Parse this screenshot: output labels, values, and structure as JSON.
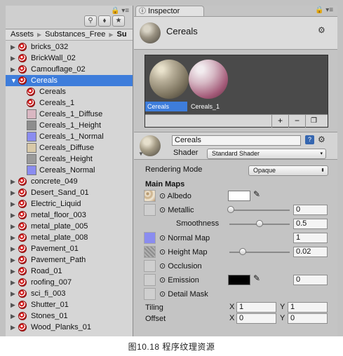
{
  "caption": "图10.18    程序纹理资源",
  "project": {
    "breadcrumb": [
      "Assets",
      "Substances_Free",
      "Su"
    ],
    "tree": [
      {
        "label": "bricks_032",
        "kind": "substance",
        "level": 0,
        "toggle": "collapsed"
      },
      {
        "label": "BrickWall_02",
        "kind": "substance",
        "level": 0,
        "toggle": "collapsed"
      },
      {
        "label": "Camouflage_02",
        "kind": "substance",
        "level": 0,
        "toggle": "collapsed"
      },
      {
        "label": "Cereals",
        "kind": "substance",
        "level": 0,
        "toggle": "expanded",
        "selected": true
      },
      {
        "label": "Cereals",
        "kind": "material",
        "level": 1
      },
      {
        "label": "Cereals_1",
        "kind": "material",
        "level": 1
      },
      {
        "label": "Cereals_1_Diffuse",
        "kind": "texture",
        "level": 1,
        "color": "#d9b7c2"
      },
      {
        "label": "Cereals_1_Height",
        "kind": "texture",
        "level": 1,
        "color": "#8d8d8d"
      },
      {
        "label": "Cereals_1_Normal",
        "kind": "texture",
        "level": 1,
        "color": "#8a8cf0"
      },
      {
        "label": "Cereals_Diffuse",
        "kind": "texture",
        "level": 1,
        "color": "#d8c9a8"
      },
      {
        "label": "Cereals_Height",
        "kind": "texture",
        "level": 1,
        "color": "#9a9a9a"
      },
      {
        "label": "Cereals_Normal",
        "kind": "texture",
        "level": 1,
        "color": "#8a8cf0"
      },
      {
        "label": "concrete_049",
        "kind": "substance",
        "level": 0,
        "toggle": "collapsed"
      },
      {
        "label": "Desert_Sand_01",
        "kind": "substance",
        "level": 0,
        "toggle": "collapsed"
      },
      {
        "label": "Electric_Liquid",
        "kind": "substance",
        "level": 0,
        "toggle": "collapsed"
      },
      {
        "label": "metal_floor_003",
        "kind": "substance",
        "level": 0,
        "toggle": "collapsed"
      },
      {
        "label": "metal_plate_005",
        "kind": "substance",
        "level": 0,
        "toggle": "collapsed"
      },
      {
        "label": "metal_plate_008",
        "kind": "substance",
        "level": 0,
        "toggle": "collapsed"
      },
      {
        "label": "Pavement_01",
        "kind": "substance",
        "level": 0,
        "toggle": "collapsed"
      },
      {
        "label": "Pavement_Path",
        "kind": "substance",
        "level": 0,
        "toggle": "collapsed"
      },
      {
        "label": "Road_01",
        "kind": "substance",
        "level": 0,
        "toggle": "collapsed"
      },
      {
        "label": "roofing_007",
        "kind": "substance",
        "level": 0,
        "toggle": "collapsed"
      },
      {
        "label": "sci_fi_003",
        "kind": "substance",
        "level": 0,
        "toggle": "collapsed"
      },
      {
        "label": "Shutter_01",
        "kind": "substance",
        "level": 0,
        "toggle": "collapsed"
      },
      {
        "label": "Stones_01",
        "kind": "substance",
        "level": 0,
        "toggle": "collapsed"
      },
      {
        "label": "Wood_Planks_01",
        "kind": "substance",
        "level": 0,
        "toggle": "collapsed"
      }
    ]
  },
  "inspector": {
    "tab_label": "Inspector",
    "asset_title": "Cereals",
    "preview": [
      "Cereals",
      "Cereals_1"
    ],
    "preview_buttons": [
      "+",
      "−"
    ],
    "material_name": "Cereals",
    "shader_label": "Shader",
    "shader": "Standard Shader",
    "rendering_mode_label": "Rendering Mode",
    "rendering_mode": "Opaque",
    "main_maps": "Main Maps",
    "albedo_label": "⊙ Albedo",
    "metallic_label": "⊙ Metallic",
    "metallic": "0",
    "smoothness_label": "Smoothness",
    "smoothness": "0.5",
    "normal_map_label": "⊙ Normal Map",
    "normal_map": "1",
    "height_map_label": "⊙ Height Map",
    "height_map": "0.02",
    "occlusion_label": "⊙ Occlusion",
    "emission_label": "⊙ Emission",
    "emission": "0",
    "detail_mask_label": "⊙ Detail Mask",
    "tiling_label": "Tiling",
    "offset_label": "Offset",
    "x_label": "X",
    "y_label": "Y",
    "tiling": [
      "1",
      "1"
    ],
    "offset": [
      "0",
      "0"
    ],
    "selection_color": "#3e7ddb"
  }
}
